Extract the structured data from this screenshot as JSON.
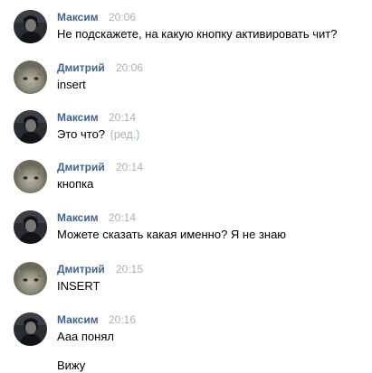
{
  "colors": {
    "author": "#42648b",
    "timestamp": "#a8b1bb",
    "text": "#000000"
  },
  "messages": [
    {
      "author": "Максим",
      "avatar": "maksim-avatar",
      "time": "20:06",
      "text": "Не подскажете, на какую кнопку активировать чит?"
    },
    {
      "author": "Дмитрий",
      "avatar": "dmitriy-cat-avatar",
      "time": "20:06",
      "text": "insert"
    },
    {
      "author": "Максим",
      "avatar": "maksim-avatar",
      "time": "20:14",
      "text": "Это что?",
      "edited": "(ред.)"
    },
    {
      "author": "Дмитрий",
      "avatar": "dmitriy-cat-avatar",
      "time": "20:14",
      "text": "кнопка"
    },
    {
      "author": "Максим",
      "avatar": "maksim-avatar",
      "time": "20:14",
      "text": "Можете сказать какая именно? Я не знаю"
    },
    {
      "author": "Дмитрий",
      "avatar": "dmitriy-cat-avatar",
      "time": "20:15",
      "text": "INSERT"
    },
    {
      "author": "Максим",
      "avatar": "maksim-avatar",
      "time": "20:16",
      "text": "Ааа понял",
      "followup": "Вижу"
    }
  ]
}
